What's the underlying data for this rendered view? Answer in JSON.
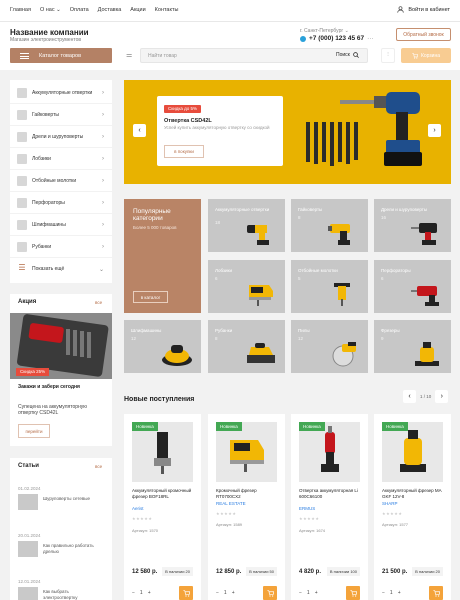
{
  "topnav": {
    "links": [
      "Главная",
      "О нас ⌄",
      "Оплата",
      "Доставка",
      "Акции",
      "Контакты"
    ],
    "login": "Войти в кабинет"
  },
  "header": {
    "company": "Название компании",
    "tagline": "Магазин электроинструментов",
    "city": "г. Санкт-Петербург ⌄",
    "phone": "+7 (000) 123 45 67",
    "more": "···",
    "callback": "Обратный звонок"
  },
  "toolbar": {
    "catalog": "Каталог товаров",
    "search_placeholder": "Найти товар",
    "search_button": "Поиск",
    "cart": "Корзина"
  },
  "sidebar": {
    "items": [
      {
        "label": "Аккумуляторные отвертки"
      },
      {
        "label": "Гайковерты"
      },
      {
        "label": "Дрели и шуруповерты"
      },
      {
        "label": "Лобзики"
      },
      {
        "label": "Отбойные молотки"
      },
      {
        "label": "Перфораторы"
      },
      {
        "label": "Шлифмашины"
      },
      {
        "label": "Рубанки"
      },
      {
        "label": "Показать ещё"
      }
    ]
  },
  "banner": {
    "badge": "Скидка до 5%",
    "title": "Отвертка CSD42L",
    "desc": "Успей купить аккумуляторную отвертку со скидкой",
    "button": "в покупки",
    "accent": "#e8b200"
  },
  "promo_tile": {
    "title": "Популярные категории",
    "subtitle": "Более 5 000 товаров",
    "button": "в каталог"
  },
  "categories": [
    {
      "name": "Аккумуляторные отвертки",
      "count": "18"
    },
    {
      "name": "Гайковерты",
      "count": "8"
    },
    {
      "name": "Дрели и шуруповерты",
      "count": "16"
    },
    {
      "name": "Лобзики",
      "count": "6"
    },
    {
      "name": "Отбойные молотки",
      "count": "5"
    },
    {
      "name": "Перфораторы",
      "count": "6"
    },
    {
      "name": "Шлифмашины",
      "count": "12"
    },
    {
      "name": "Рубанки",
      "count": "8"
    },
    {
      "name": "Пилы",
      "count": "12"
    },
    {
      "name": "Фрезеры",
      "count": "9"
    }
  ],
  "promo": {
    "heading": "Акция",
    "all": "все",
    "badge": "Скидка 25%",
    "title": "Закажи и забери сегодня",
    "desc": "Супецена на аккумуляторную отвертку CSD42L",
    "button": "перейти"
  },
  "articles": {
    "heading": "Статьи",
    "all": "все",
    "items": [
      {
        "date": "01.02.2024",
        "title": "Шуруповерты сетевые"
      },
      {
        "date": "20.01.2024",
        "title": "Как правильно работать дрелью"
      },
      {
        "date": "12.01.2024",
        "title": "Как выбрать электроотвертку"
      }
    ]
  },
  "new_arrivals": {
    "heading": "Новые поступления",
    "page": "1 / 10",
    "products": [
      {
        "badge": "Новинка",
        "name": "Аккумуляторный кромочный фрезер BOF18RL",
        "brand": "Aerist",
        "sku": "Артикул: 1570",
        "price": "12 580 р.",
        "stock": "В наличии 20"
      },
      {
        "badge": "Новинка",
        "name": "Кромочный фрезер RT0700CX2",
        "brand": "REAL ESTATE",
        "sku": "Артикул: 1589",
        "price": "12 850 р.",
        "stock": "В наличии 50"
      },
      {
        "badge": "Новинка",
        "name": "Отвертка аккумуляторная Li 600С66100",
        "brand": "ERMUS",
        "sku": "Артикул: 1674",
        "price": "4 820 р.",
        "stock": "В наличии 100"
      },
      {
        "badge": "Новинка",
        "name": "Аккумуляторный фрезер MA GKF 12V-8",
        "brand": "SHARP",
        "sku": "Артикул: 1577",
        "price": "21 500 р.",
        "stock": "В наличии 20"
      }
    ],
    "qty": "1"
  }
}
